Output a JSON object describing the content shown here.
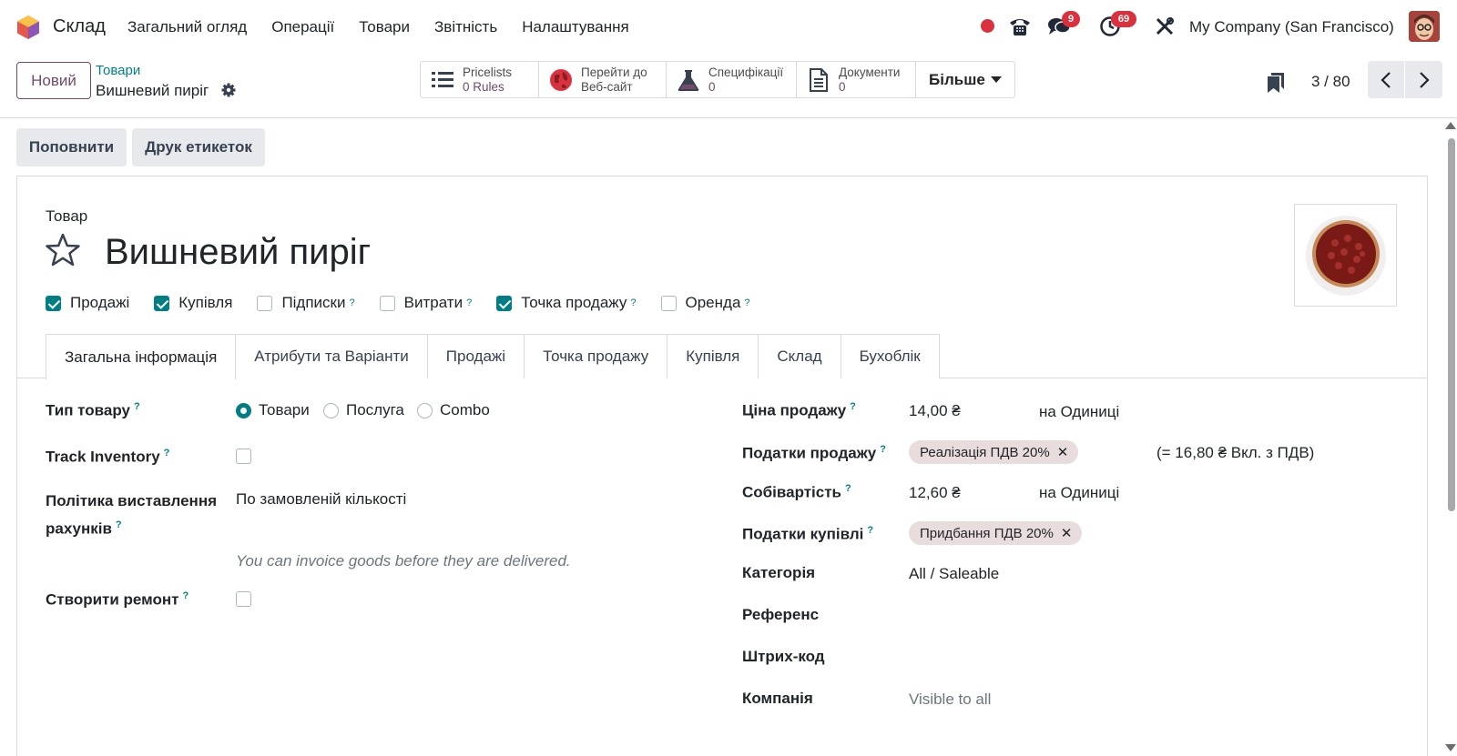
{
  "navbar": {
    "app_name": "Склад",
    "menu": [
      "Загальний огляд",
      "Операції",
      "Товари",
      "Звітність",
      "Налаштування"
    ],
    "chat_badge": "9",
    "activity_badge": "69",
    "company": "My Company (San Francisco)"
  },
  "control_panel": {
    "new_label": "Новий",
    "breadcrumb_parent": "Товари",
    "breadcrumb_current": "Вишневий пиріг",
    "smart_buttons": {
      "pricelists_label": "Pricelists",
      "pricelists_value": "0",
      "pricelists_unit": "Rules",
      "website_line1": "Перейти до",
      "website_line2": "Веб-сайт",
      "bom_label": "Специфікації",
      "bom_value": "0",
      "docs_label": "Документи",
      "docs_value": "0",
      "more_label": "Більше"
    },
    "pager": "3 / 80"
  },
  "actions": {
    "replenish": "Поповнити",
    "print_labels": "Друк етикеток"
  },
  "product": {
    "type_caption": "Товар",
    "name": "Вишневий пиріг",
    "flags": [
      {
        "label": "Продажі",
        "checked": true,
        "tip": ""
      },
      {
        "label": "Купівля",
        "checked": true,
        "tip": ""
      },
      {
        "label": "Підписки",
        "checked": false,
        "tip": "?"
      },
      {
        "label": "Витрати",
        "checked": false,
        "tip": "?"
      },
      {
        "label": "Точка продажу",
        "checked": true,
        "tip": "?"
      },
      {
        "label": "Оренда",
        "checked": false,
        "tip": "?"
      }
    ]
  },
  "tabs": [
    "Загальна інформація",
    "Атрибути та Варіанти",
    "Продажі",
    "Точка продажу",
    "Купівля",
    "Склад",
    "Бухоблік"
  ],
  "left_fields": {
    "product_type_label": "Тип товару",
    "type_options": [
      "Товари",
      "Послуга",
      "Combo"
    ],
    "track_inventory_label": "Track Inventory",
    "invoice_policy_label_1": "Політика виставлення",
    "invoice_policy_label_2": "рахунків",
    "invoice_policy_value": "По замовленій кількості",
    "invoice_hint": "You can invoice goods before they are delivered.",
    "repair_label": "Створити ремонт"
  },
  "right_fields": {
    "sale_price_label": "Ціна продажу",
    "sale_price_value": "14,00 ₴",
    "sale_price_uom": "на Одиниці",
    "sale_tax_label": "Податки продажу",
    "sale_tax_tag": "Реалізація ПДВ 20%",
    "sale_tax_incl": "(= 16,80 ₴ Вкл. з ПДВ)",
    "cost_label": "Собівартість",
    "cost_value": "12,60 ₴",
    "cost_uom": "на Одиниці",
    "purchase_tax_label": "Податки купівлі",
    "purchase_tax_tag": "Придбання ПДВ 20%",
    "category_label": "Категорія",
    "category_value": "All / Saleable",
    "reference_label": "Референс",
    "barcode_label": "Штрих-код",
    "company_label": "Компанія",
    "company_value": "Visible to all"
  },
  "colors": {
    "brand": "#714b67",
    "accent": "#017e84",
    "badge": "#d9323e"
  }
}
